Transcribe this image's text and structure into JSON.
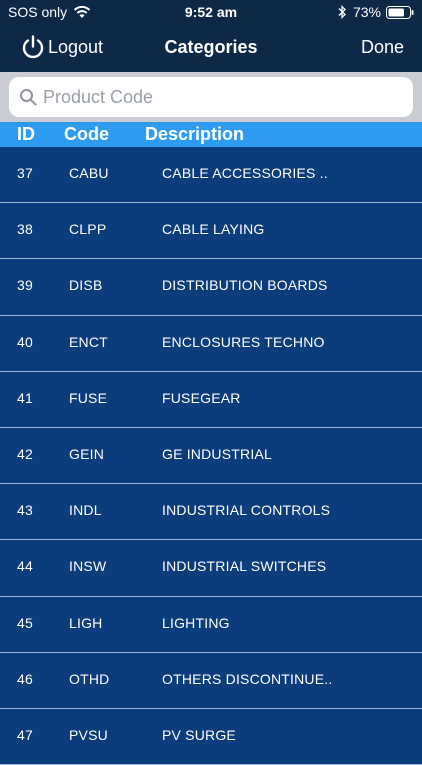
{
  "status": {
    "carrier": "SOS only",
    "time": "9:52 am",
    "battery": "73%",
    "icons": [
      "wifi-icon",
      "bluetooth-icon",
      "battery-icon"
    ]
  },
  "nav": {
    "logout_label": "Logout",
    "title": "Categories",
    "done_label": "Done",
    "icon": "power-icon"
  },
  "search": {
    "placeholder": "Product Code",
    "value": "",
    "icon": "search-icon"
  },
  "table": {
    "headers": {
      "id": "ID",
      "code": "Code",
      "description": "Description"
    },
    "rows": [
      {
        "id": "37",
        "code": "CABU",
        "description": "CABLE ACCESSORIES  .."
      },
      {
        "id": "38",
        "code": "CLPP",
        "description": "CABLE LAYING"
      },
      {
        "id": "39",
        "code": "DISB",
        "description": "DISTRIBUTION BOARDS"
      },
      {
        "id": "40",
        "code": "ENCT",
        "description": "ENCLOSURES  TECHNO"
      },
      {
        "id": "41",
        "code": "FUSE",
        "description": "FUSEGEAR"
      },
      {
        "id": "42",
        "code": "GEIN",
        "description": "GE INDUSTRIAL"
      },
      {
        "id": "43",
        "code": "INDL",
        "description": "INDUSTRIAL CONTROLS"
      },
      {
        "id": "44",
        "code": "INSW",
        "description": "INDUSTRIAL SWITCHES"
      },
      {
        "id": "45",
        "code": "LIGH",
        "description": "LIGHTING"
      },
      {
        "id": "46",
        "code": "OTHD",
        "description": "OTHERS  DISCONTINUE.."
      },
      {
        "id": "47",
        "code": "PVSU",
        "description": "PV  SURGE"
      }
    ]
  },
  "colors": {
    "nav_bg": "#0e2848",
    "header_bg": "#2d9cf0",
    "row_bg": "#0b3d7c",
    "divider": "#9db8d8",
    "search_bar_bg": "#c9cdd3"
  }
}
